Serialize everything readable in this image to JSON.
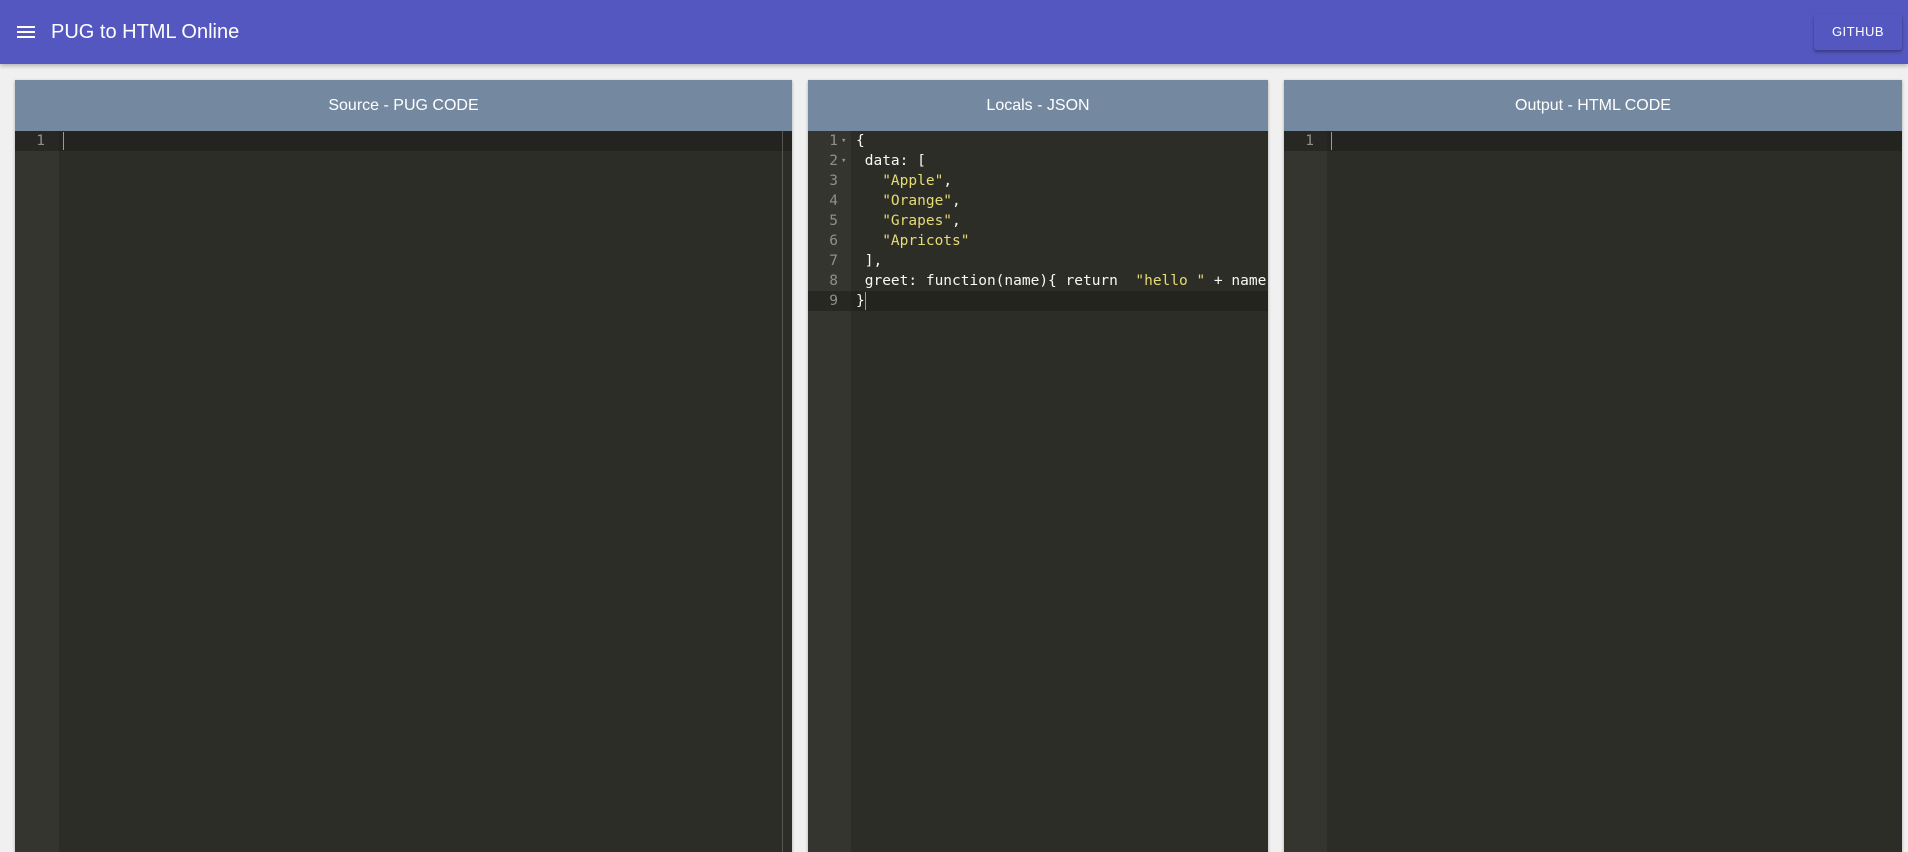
{
  "header": {
    "title": "PUG to HTML Online",
    "menu_icon": "hamburger-menu-icon",
    "github_label": "GITHUB"
  },
  "panels": {
    "source": {
      "title": "Source - PUG CODE",
      "line_numbers": [
        "1"
      ]
    },
    "locals": {
      "title": "Locals - JSON",
      "line_numbers": [
        "1",
        "2",
        "3",
        "4",
        "5",
        "6",
        "7",
        "8",
        "9"
      ],
      "fold_markers": [
        "▾",
        "▾"
      ],
      "code": {
        "l1": "{",
        "l2": " data: [",
        "l3_str": "\"Apple\"",
        "l3_rest": ",",
        "l4_str": "\"Orange\"",
        "l4_rest": ",",
        "l5_str": "\"Grapes\"",
        "l5_rest": ",",
        "l6_str": "\"Apricots\"",
        "l7": " ],",
        "l8_pre": " greet: function(name){ return  ",
        "l8_str": "\"hello \"",
        "l8_post": " + name",
        "l9": "}"
      }
    },
    "output": {
      "title": "Output - HTML CODE",
      "line_numbers": [
        "1"
      ]
    }
  },
  "colors": {
    "appbar": "#5557c0",
    "panel_header": "#7489a0",
    "editor_bg": "#2d2d27",
    "gutter_bg": "#34352f",
    "string": "#e6db74"
  }
}
